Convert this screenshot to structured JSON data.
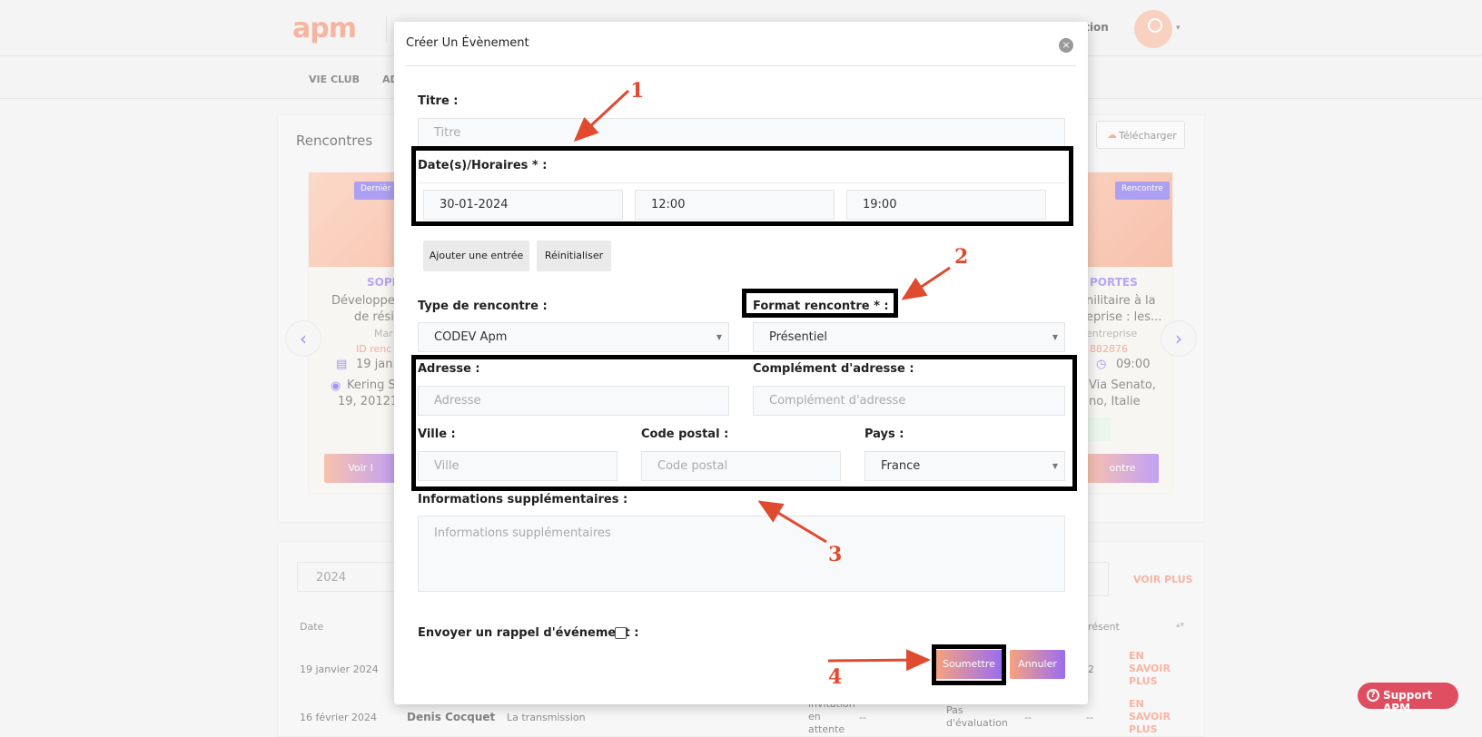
{
  "app": {
    "logo": "apm",
    "top_right_text": "iation"
  },
  "nav": {
    "items": [
      "VIE CLUB",
      "AD"
    ]
  },
  "section": {
    "title": "Rencontres",
    "download_label": "Télécharger"
  },
  "cards": {
    "left": {
      "badge": "Dernièr",
      "org": "SOPH",
      "title_line1": "Développe",
      "title_line2": "de rési",
      "sub": "Mar",
      "id": "ID renc",
      "date": "19 jan.",
      "addr_line1": "Kering S",
      "addr_line2": "19, 20121,",
      "cta": "Voir l"
    },
    "right": {
      "badge": "Rencontre",
      "org": "PORTES",
      "title_line1": "nilitaire à la",
      "title_line2": "eprise : les...",
      "sub": "entreprise",
      "id": "882876",
      "time": "09:00",
      "addr_line1": "Via Senato,",
      "addr_line2": "no, Italie",
      "cta": "ontre"
    }
  },
  "lower": {
    "year": "2024",
    "voir_plus": "VOIR PLUS",
    "headers": {
      "date": "Date",
      "present": "résent"
    },
    "rows": [
      {
        "date": "19 janvier 2024",
        "num": "2",
        "link": [
          "EN",
          "SAVOIR",
          "PLUS"
        ]
      },
      {
        "date": "16 février 2024",
        "name": "Denis Cocquet",
        "theme": "La transmission",
        "status": [
          "invitation",
          "en",
          "attente"
        ],
        "dash1": "--",
        "eval": [
          "Pas",
          "d'évaluation"
        ],
        "dash2": "--",
        "dash3": "--",
        "link": [
          "EN",
          "SAVOIR",
          "PLUS"
        ]
      }
    ]
  },
  "support": {
    "label": "Support APM",
    "q": "?"
  },
  "modal": {
    "title": "Créer Un Évènement",
    "close": "×",
    "titre_label": "Titre :",
    "titre_placeholder": "Titre",
    "dates_label": "Date(s)/Horaires * :",
    "date_value": "30-01-2024",
    "start_time": "12:00",
    "end_time": "19:00",
    "add_entry": "Ajouter une entrée",
    "reset": "Réinitialiser",
    "type_label": "Type de rencontre :",
    "type_value": "CODEV Apm",
    "format_label": "Format rencontre * :",
    "format_value": "Présentiel",
    "adresse_label": "Adresse :",
    "adresse_placeholder": "Adresse",
    "complement_label": "Complément d'adresse :",
    "complement_placeholder": "Complément d'adresse",
    "ville_label": "Ville :",
    "ville_placeholder": "Ville",
    "cp_label": "Code postal :",
    "cp_placeholder": "Code postal",
    "pays_label": "Pays :",
    "pays_value": "France",
    "infos_label": "Informations supplémentaires :",
    "infos_placeholder": "Informations supplémentaires",
    "rappel_label": "Envoyer un rappel d'événement :",
    "submit": "Soumettre",
    "cancel": "Annuler"
  },
  "annotations": {
    "n1": "1",
    "n2": "2",
    "n3": "3",
    "n4": "4",
    "color": "#e04a2f"
  },
  "colors": {
    "accent_peach": "#f7a27e",
    "accent_purple": "#9a6cf2",
    "support_red": "#d8283d"
  }
}
